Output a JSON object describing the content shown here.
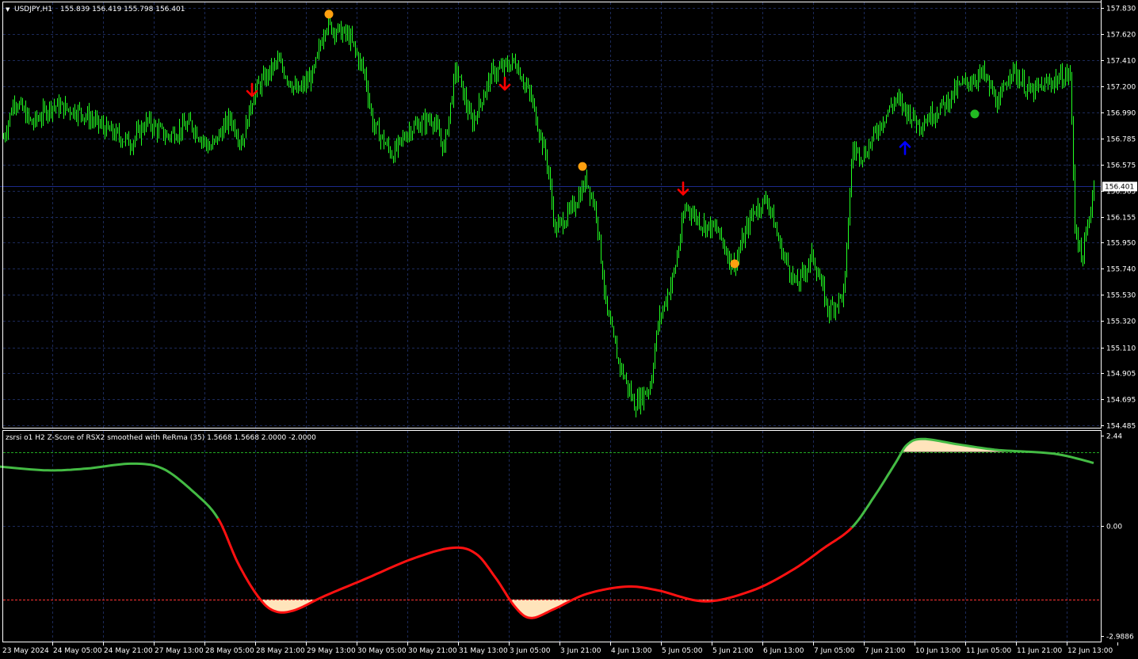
{
  "main": {
    "symbol_title": "USDJPY,H1",
    "ohlc": "155.839 156.419 155.798 156.401",
    "current_price_label": "156.401",
    "current_price": 156.401,
    "price_axis_labels": [
      "157.830",
      "157.620",
      "157.410",
      "157.200",
      "156.990",
      "156.785",
      "156.575",
      "156.365",
      "156.155",
      "155.950",
      "155.740",
      "155.530",
      "155.320",
      "155.110",
      "154.905",
      "154.695",
      "154.485"
    ]
  },
  "indicator": {
    "title": "zsrsi o1 H2 Z-Score of RSX2 smoothed with ReRma (35) 1.5668 1.5668 2.0000 -2.0000",
    "axis_labels": [
      "2.44",
      "0.00",
      "-2.9886"
    ],
    "upper_level": 2.0,
    "lower_level": -2.0
  },
  "time_axis": {
    "labels": [
      "23 May 2024",
      "24 May 05:00",
      "24 May 21:00",
      "27 May 13:00",
      "28 May 05:00",
      "28 May 21:00",
      "29 May 13:00",
      "30 May 05:00",
      "30 May 21:00",
      "31 May 13:00",
      "3 Jun 05:00",
      "3 Jun 21:00",
      "4 Jun 13:00",
      "5 Jun 05:00",
      "5 Jun 21:00",
      "6 Jun 13:00",
      "7 Jun 05:00",
      "7 Jun 21:00",
      "10 Jun 13:00",
      "11 Jun 05:00",
      "11 Jun 21:00",
      "12 Jun 13:00"
    ]
  },
  "colors": {
    "background": "#000000",
    "grid": "#1c2a5a",
    "candle": "#22ff22",
    "osc_up": "#44bb44",
    "osc_down": "#ff1111",
    "fill": "#ffe4bb",
    "signal_down_arrow": "#ff0000",
    "signal_up_arrow": "#0000ff",
    "dot_orange": "#ffa010",
    "dot_green": "#22bb22",
    "level_upper": "#22aa22",
    "level_lower": "#ff3333"
  },
  "chart_data": [
    {
      "type": "candlestick",
      "title": "USDJPY,H1",
      "ylim": [
        154.485,
        157.83
      ],
      "key_points": [
        {
          "x": 0,
          "y": 156.7
        },
        {
          "x": 18,
          "y": 157.1
        },
        {
          "x": 40,
          "y": 156.9
        },
        {
          "x": 65,
          "y": 157.05
        },
        {
          "x": 100,
          "y": 157.0
        },
        {
          "x": 135,
          "y": 156.85
        },
        {
          "x": 165,
          "y": 156.75
        },
        {
          "x": 185,
          "y": 156.92
        },
        {
          "x": 210,
          "y": 156.8
        },
        {
          "x": 240,
          "y": 156.9
        },
        {
          "x": 265,
          "y": 156.7
        },
        {
          "x": 290,
          "y": 156.95
        },
        {
          "x": 305,
          "y": 156.75
        },
        {
          "x": 320,
          "y": 157.15
        },
        {
          "x": 350,
          "y": 157.4
        },
        {
          "x": 375,
          "y": 157.15
        },
        {
          "x": 395,
          "y": 157.3
        },
        {
          "x": 410,
          "y": 157.7
        },
        {
          "x": 440,
          "y": 157.6
        },
        {
          "x": 460,
          "y": 157.3
        },
        {
          "x": 470,
          "y": 156.9
        },
        {
          "x": 495,
          "y": 156.65
        },
        {
          "x": 515,
          "y": 156.85
        },
        {
          "x": 545,
          "y": 156.95
        },
        {
          "x": 560,
          "y": 156.7
        },
        {
          "x": 575,
          "y": 157.35
        },
        {
          "x": 595,
          "y": 156.9
        },
        {
          "x": 620,
          "y": 157.3
        },
        {
          "x": 650,
          "y": 157.4
        },
        {
          "x": 670,
          "y": 157.1
        },
        {
          "x": 690,
          "y": 156.6
        },
        {
          "x": 700,
          "y": 156.05
        },
        {
          "x": 720,
          "y": 156.2
        },
        {
          "x": 740,
          "y": 156.45
        },
        {
          "x": 752,
          "y": 156.2
        },
        {
          "x": 765,
          "y": 155.4
        },
        {
          "x": 780,
          "y": 155.0
        },
        {
          "x": 800,
          "y": 154.65
        },
        {
          "x": 820,
          "y": 154.8
        },
        {
          "x": 830,
          "y": 155.3
        },
        {
          "x": 850,
          "y": 155.7
        },
        {
          "x": 865,
          "y": 156.25
        },
        {
          "x": 885,
          "y": 156.1
        },
        {
          "x": 905,
          "y": 156.05
        },
        {
          "x": 925,
          "y": 155.75
        },
        {
          "x": 950,
          "y": 156.2
        },
        {
          "x": 968,
          "y": 156.3
        },
        {
          "x": 985,
          "y": 155.9
        },
        {
          "x": 1005,
          "y": 155.6
        },
        {
          "x": 1025,
          "y": 155.85
        },
        {
          "x": 1045,
          "y": 155.4
        },
        {
          "x": 1065,
          "y": 155.55
        },
        {
          "x": 1075,
          "y": 156.7
        },
        {
          "x": 1090,
          "y": 156.65
        },
        {
          "x": 1110,
          "y": 156.9
        },
        {
          "x": 1130,
          "y": 157.1
        },
        {
          "x": 1160,
          "y": 156.9
        },
        {
          "x": 1190,
          "y": 157.05
        },
        {
          "x": 1210,
          "y": 157.2
        },
        {
          "x": 1240,
          "y": 157.3
        },
        {
          "x": 1260,
          "y": 157.05
        },
        {
          "x": 1275,
          "y": 157.35
        },
        {
          "x": 1300,
          "y": 157.15
        },
        {
          "x": 1330,
          "y": 157.25
        },
        {
          "x": 1350,
          "y": 157.3
        },
        {
          "x": 1356,
          "y": 156.1
        },
        {
          "x": 1365,
          "y": 155.8
        },
        {
          "x": 1380,
          "y": 156.4
        }
      ],
      "signals": [
        {
          "kind": "down-arrow",
          "x": 318,
          "y": 157.17
        },
        {
          "kind": "down-arrow",
          "x": 637,
          "y": 157.22
        },
        {
          "kind": "down-arrow",
          "x": 862,
          "y": 156.38
        },
        {
          "kind": "up-arrow",
          "x": 1142,
          "y": 156.71
        },
        {
          "kind": "orange-dot",
          "x": 415,
          "y": 157.78
        },
        {
          "kind": "orange-dot",
          "x": 735,
          "y": 156.56
        },
        {
          "kind": "orange-dot",
          "x": 927,
          "y": 155.78
        },
        {
          "kind": "green-dot",
          "x": 1230,
          "y": 156.98
        }
      ]
    },
    {
      "type": "line",
      "title": "zsrsi o1 H2 Z-Score of RSX2 smoothed with ReRma (35)",
      "ylim": [
        -2.9886,
        2.44
      ],
      "levels": [
        2.0,
        -2.0
      ],
      "x": [
        0,
        60,
        110,
        165,
        205,
        245,
        275,
        300,
        325,
        345,
        370,
        410,
        460,
        520,
        570,
        600,
        625,
        650,
        670,
        700,
        740,
        790,
        830,
        890,
        950,
        1000,
        1040,
        1075,
        1105,
        1130,
        1145,
        1165,
        1210,
        1260,
        1330,
        1380
      ],
      "y": [
        1.6,
        1.5,
        1.55,
        1.68,
        1.55,
        0.9,
        0.2,
        -1.0,
        -1.9,
        -2.3,
        -2.3,
        -1.9,
        -1.45,
        -0.9,
        -0.6,
        -0.75,
        -1.4,
        -2.2,
        -2.5,
        -2.25,
        -1.85,
        -1.65,
        -1.75,
        -2.05,
        -1.75,
        -1.2,
        -0.6,
        -0.05,
        0.85,
        1.7,
        2.2,
        2.35,
        2.2,
        2.05,
        1.95,
        1.7
      ],
      "color_segments": [
        {
          "from_x": 0,
          "to_x": 275,
          "color": "up"
        },
        {
          "from_x": 275,
          "to_x": 1075,
          "color": "down"
        },
        {
          "from_x": 1075,
          "to_x": 1380,
          "color": "up"
        }
      ]
    }
  ]
}
